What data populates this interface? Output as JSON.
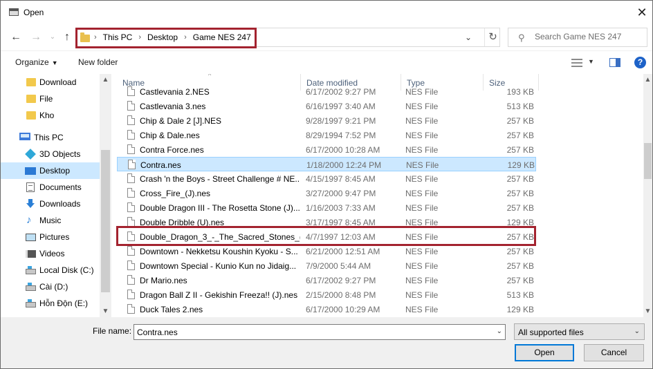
{
  "window": {
    "title": "Open"
  },
  "address": {
    "crumbs": [
      "This PC",
      "Desktop",
      "Game NES 247"
    ]
  },
  "search": {
    "placeholder": "Search Game NES 247"
  },
  "toolbar": {
    "organize_label": "Organize",
    "new_folder_label": "New folder"
  },
  "nav": {
    "items": [
      {
        "label": "Download",
        "icon": "folder-icon"
      },
      {
        "label": "File",
        "icon": "folder-icon"
      },
      {
        "label": "Kho",
        "icon": "folder-icon"
      },
      {
        "label": "This PC",
        "icon": "computer-icon"
      },
      {
        "label": "3D Objects",
        "icon": "3d-objects-icon"
      },
      {
        "label": "Desktop",
        "icon": "desktop-icon"
      },
      {
        "label": "Documents",
        "icon": "documents-icon"
      },
      {
        "label": "Downloads",
        "icon": "downloads-icon"
      },
      {
        "label": "Music",
        "icon": "music-icon"
      },
      {
        "label": "Pictures",
        "icon": "pictures-icon"
      },
      {
        "label": "Videos",
        "icon": "videos-icon"
      },
      {
        "label": "Local Disk (C:)",
        "icon": "disk-icon"
      },
      {
        "label": "Cài (D:)",
        "icon": "disk-icon"
      },
      {
        "label": "Hỗn Độn (E:)",
        "icon": "disk-icon"
      }
    ]
  },
  "columns": {
    "name": "Name",
    "date": "Date modified",
    "type": "Type",
    "size": "Size"
  },
  "files": [
    {
      "name": "Castlevania 2.NES",
      "date": "6/17/2002 9:27 PM",
      "type": "NES File",
      "size": "193 KB"
    },
    {
      "name": "Castlevania 3.nes",
      "date": "6/16/1997 3:40 AM",
      "type": "NES File",
      "size": "513 KB"
    },
    {
      "name": "Chip & Dale 2 [J].NES",
      "date": "9/28/1997 9:21 PM",
      "type": "NES File",
      "size": "257 KB"
    },
    {
      "name": "Chip & Dale.nes",
      "date": "8/29/1994 7:52 PM",
      "type": "NES File",
      "size": "257 KB"
    },
    {
      "name": "Contra Force.nes",
      "date": "6/17/2000 10:28 AM",
      "type": "NES File",
      "size": "257 KB"
    },
    {
      "name": "Contra.nes",
      "date": "1/18/2000 12:24 PM",
      "type": "NES File",
      "size": "129 KB"
    },
    {
      "name": "Crash 'n the Boys - Street Challenge # NE...",
      "date": "4/15/1997 8:45 AM",
      "type": "NES File",
      "size": "257 KB"
    },
    {
      "name": "Cross_Fire_(J).nes",
      "date": "3/27/2000 9:47 PM",
      "type": "NES File",
      "size": "257 KB"
    },
    {
      "name": "Double Dragon III - The Rosetta Stone (J)....",
      "date": "1/16/2003 7:33 AM",
      "type": "NES File",
      "size": "257 KB"
    },
    {
      "name": "Double Dribble (U).nes",
      "date": "3/17/1997 8:45 AM",
      "type": "NES File",
      "size": "129 KB"
    },
    {
      "name": "Double_Dragon_3_-_The_Sacred_Stones_(...",
      "date": "4/7/1997 12:03 AM",
      "type": "NES File",
      "size": "257 KB"
    },
    {
      "name": "Downtown - Nekketsu Koushin Kyoku - S...",
      "date": "6/21/2000 12:51 AM",
      "type": "NES File",
      "size": "257 KB"
    },
    {
      "name": "Downtown Special - Kunio Kun no Jidaig...",
      "date": "7/9/2000 5:44 AM",
      "type": "NES File",
      "size": "257 KB"
    },
    {
      "name": "Dr Mario.nes",
      "date": "6/17/2002 9:27 PM",
      "type": "NES File",
      "size": "257 KB"
    },
    {
      "name": "Dragon Ball Z II - Gekishin Freeza!! (J).nes",
      "date": "2/15/2000 8:48 PM",
      "type": "NES File",
      "size": "513 KB"
    },
    {
      "name": "Duck Tales 2.nes",
      "date": "6/17/2000 10:29 AM",
      "type": "NES File",
      "size": "129 KB"
    }
  ],
  "bottom": {
    "file_name_label": "File name:",
    "file_name_value": "Contra.nes",
    "filter_label": "All supported files",
    "open_label": "Open",
    "cancel_label": "Cancel"
  }
}
